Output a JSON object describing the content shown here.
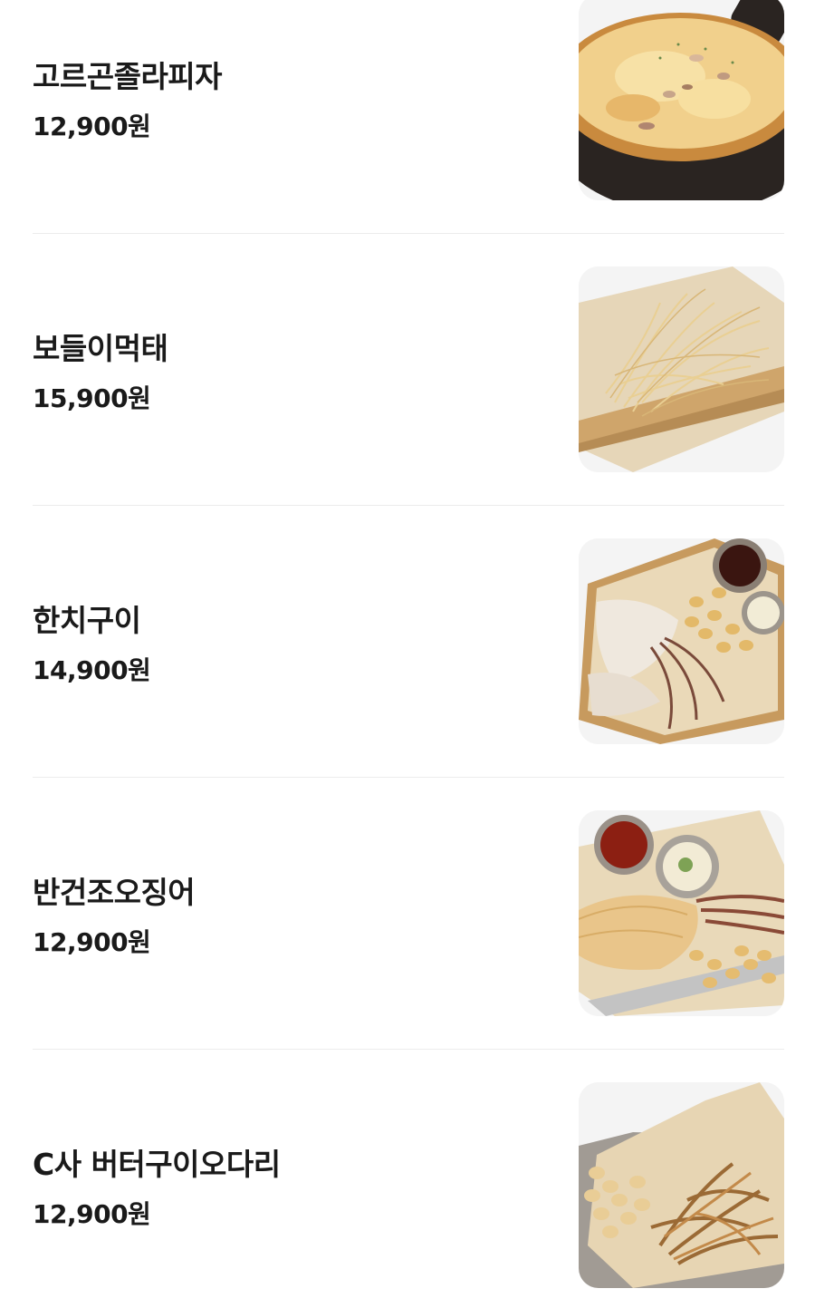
{
  "menu": {
    "items": [
      {
        "name": "고르곤졸라피자",
        "price": "12,900원",
        "image_icon": "gorgonzola-pizza-photo"
      },
      {
        "name": "보들이먹태",
        "price": "15,900원",
        "image_icon": "dried-pollack-photo"
      },
      {
        "name": "한치구이",
        "price": "14,900원",
        "image_icon": "grilled-squid-photo"
      },
      {
        "name": "반건조오징어",
        "price": "12,900원",
        "image_icon": "half-dried-squid-photo"
      },
      {
        "name": "C사 버터구이오다리",
        "price": "12,900원",
        "image_icon": "butter-grilled-squid-legs-photo"
      }
    ]
  }
}
